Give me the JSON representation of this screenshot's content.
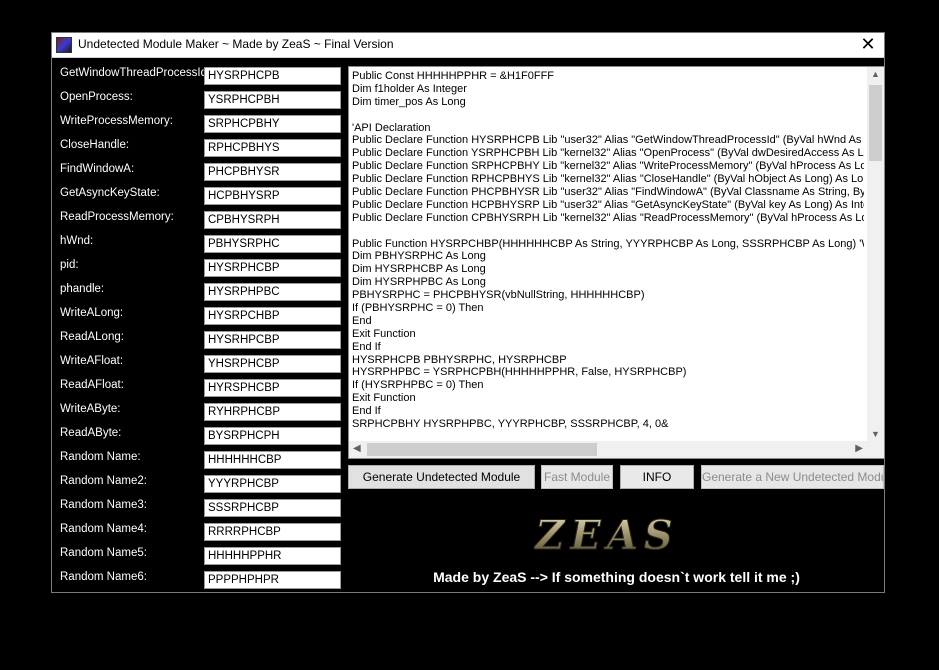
{
  "window": {
    "title": "Undetected Module Maker ~ Made by ZeaS ~ Final Version",
    "close_glyph": "✕",
    "app_icon": "app-icon"
  },
  "fields": [
    {
      "label": "GetWindowThreadProcessId:",
      "value": "HYSRPHCPB"
    },
    {
      "label": "OpenProcess:",
      "value": "YSRPHCPBH"
    },
    {
      "label": "WriteProcessMemory:",
      "value": "SRPHCPBHY"
    },
    {
      "label": "CloseHandle:",
      "value": "RPHCPBHYS"
    },
    {
      "label": "FindWindowA:",
      "value": "PHCPBHYSR"
    },
    {
      "label": "GetAsyncKeyState:",
      "value": "HCPBHYSRP"
    },
    {
      "label": "ReadProcessMemory:",
      "value": "CPBHYSRPH"
    },
    {
      "label": "hWnd:",
      "value": "PBHYSRPHC"
    },
    {
      "label": "pid:",
      "value": "HYSRPHCBP"
    },
    {
      "label": "phandle:",
      "value": "HYSRPHPBC"
    },
    {
      "label": "WriteALong:",
      "value": "HYSRPCHBP"
    },
    {
      "label": "ReadALong:",
      "value": "HYSRHPCBP"
    },
    {
      "label": "WriteAFloat:",
      "value": "YHSRPHCBP"
    },
    {
      "label": "ReadAFloat:",
      "value": "HYRSPHCBP"
    },
    {
      "label": "WriteAByte:",
      "value": "RYHRPHCBP"
    },
    {
      "label": "ReadAByte:",
      "value": "BYSRPHCPH"
    },
    {
      "label": "Random Name:",
      "value": "HHHHHHCBP"
    },
    {
      "label": "Random Name2:",
      "value": "YYYRPHCBP"
    },
    {
      "label": "Random Name3:",
      "value": "SSSRPHCBP"
    },
    {
      "label": "Random Name4:",
      "value": "RRRRPHCBP"
    },
    {
      "label": "Random Name5:",
      "value": "HHHHHPPHR"
    },
    {
      "label": "Random Name6:",
      "value": "PPPPHPHPR"
    }
  ],
  "code_lines": [
    "Public Const HHHHHPPHR = &H1F0FFF",
    "Dim f1holder As Integer",
    "Dim timer_pos As Long",
    "",
    "'API Declaration",
    "Public Declare Function HYSRPHCPB Lib \"user32\" Alias \"GetWindowThreadProcessId\" (ByVal hWnd As Lo",
    "Public Declare Function YSRPHCPBH Lib \"kernel32\" Alias \"OpenProcess\" (ByVal dwDesiredAccess As Long",
    "Public Declare Function SRPHCPBHY Lib \"kernel32\" Alias \"WriteProcessMemory\" (ByVal hProcess As Long",
    "Public Declare Function RPHCPBHYS Lib \"kernel32\" Alias \"CloseHandle\" (ByVal hObject As Long) As Long",
    "Public Declare Function PHCPBHYSR Lib \"user32\" Alias \"FindWindowA\" (ByVal Classname As String, ByVal",
    "Public Declare Function HCPBHYSRP Lib \"user32\" Alias \"GetAsyncKeyState\" (ByVal key As Long) As Intege",
    "Public Declare Function CPBHYSRPH Lib \"kernel32\" Alias \"ReadProcessMemory\" (ByVal hProcess As Long",
    "",
    "Public Function HYSRPCHBP(HHHHHHCBP As String, YYYRPHCBP As Long, SSSRPHCBP As Long) 'Writ",
    "Dim PBHYSRPHC As Long",
    "Dim HYSRPHCBP As Long",
    "Dim HYSRPHPBC As Long",
    "PBHYSRPHC = PHCPBHYSR(vbNullString, HHHHHHCBP)",
    "If (PBHYSRPHC = 0) Then",
    "End",
    "Exit Function",
    "End If",
    "HYSRPHCPB PBHYSRPHC, HYSRPHCBP",
    "HYSRPHPBC = YSRPHCPBH(HHHHHPPHR, False, HYSRPHCBP)",
    "If (HYSRPHPBC = 0) Then",
    "Exit Function",
    "End If",
    "SRPHCPBHY HYSRPHPBC, YYYRPHCBP, SSSRPHCBP, 4, 0&"
  ],
  "scrollbar": {
    "up": "▲",
    "down": "▼",
    "left": "◀",
    "right": "▶"
  },
  "buttons": {
    "generate": "Generate Undetected Module",
    "fast": "Fast Module",
    "info": "INFO",
    "generate_new": "Generate a New Undetected Module"
  },
  "logo_text": "ZEAS",
  "tagline": "Made by ZeaS --> If something doesn`t work tell it me ;)"
}
